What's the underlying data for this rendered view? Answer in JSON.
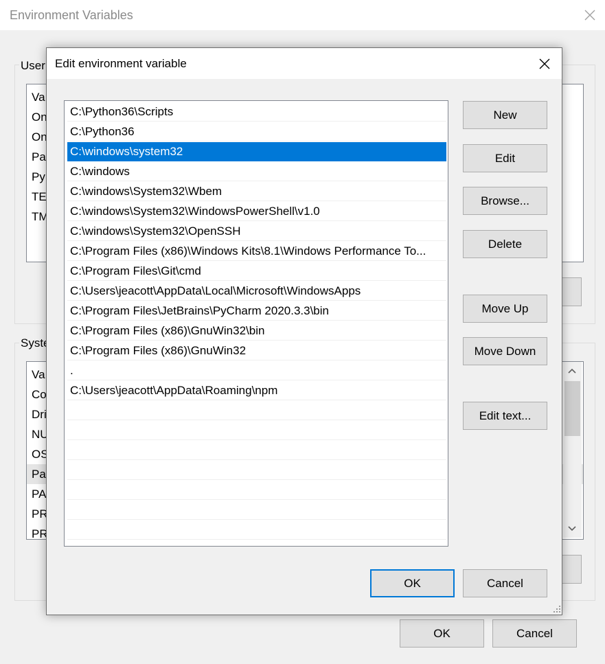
{
  "background_window": {
    "title": "Environment Variables",
    "user_group_label": "User",
    "user_list_fragments": [
      "Va",
      "On",
      "On",
      "Pat",
      "Py",
      "TE",
      "TM"
    ],
    "system_group_label": "Syste",
    "system_list_fragments": [
      "Va",
      "Co",
      "Dri",
      "NU",
      "OS",
      "Pat",
      "PA",
      "PR",
      "PR"
    ],
    "ok_label": "OK",
    "cancel_label": "Cancel"
  },
  "dialog": {
    "title": "Edit environment variable",
    "paths": [
      "C:\\Python36\\Scripts",
      "C:\\Python36",
      "C:\\windows\\system32",
      "C:\\windows",
      "C:\\windows\\System32\\Wbem",
      "C:\\windows\\System32\\WindowsPowerShell\\v1.0",
      "C:\\windows\\System32\\OpenSSH",
      "C:\\Program Files (x86)\\Windows Kits\\8.1\\Windows Performance To...",
      "C:\\Program Files\\Git\\cmd",
      "C:\\Users\\jeacott\\AppData\\Local\\Microsoft\\WindowsApps",
      "C:\\Program Files\\JetBrains\\PyCharm 2020.3.3\\bin",
      "C:\\Program Files (x86)\\GnuWin32\\bin",
      "C:\\Program Files (x86)\\GnuWin32",
      ".",
      "C:\\Users\\jeacott\\AppData\\Roaming\\npm"
    ],
    "selected_index": 2,
    "buttons": {
      "new": "New",
      "edit": "Edit",
      "browse": "Browse...",
      "delete": "Delete",
      "move_up": "Move Up",
      "move_down": "Move Down",
      "edit_text": "Edit text...",
      "ok": "OK",
      "cancel": "Cancel"
    }
  },
  "colors": {
    "selection": "#0078d7",
    "default_button_border": "#0078d7",
    "window_bg": "#f0f0f0"
  },
  "icons": [
    "close-icon",
    "scroll-up-icon",
    "scroll-down-icon",
    "resize-grip-icon"
  ]
}
